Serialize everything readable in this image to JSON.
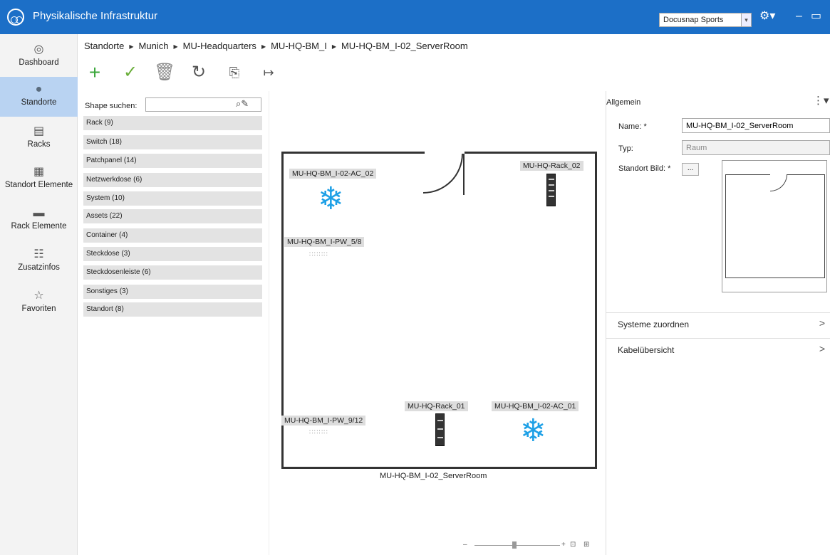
{
  "app": {
    "title": "Physikalische Infrastruktur",
    "tenant": "Docusnap Sports"
  },
  "nav": [
    {
      "label": "Dashboard",
      "icon": "dashboard-icon",
      "glyph": "◎"
    },
    {
      "label": "Standorte",
      "icon": "location-pin-icon",
      "glyph": "●"
    },
    {
      "label": "Racks",
      "icon": "rack-icon",
      "glyph": "▤"
    },
    {
      "label": "Standort Elemente",
      "icon": "site-elements-icon",
      "glyph": "▦"
    },
    {
      "label": "Rack Elemente",
      "icon": "rack-elements-icon",
      "glyph": "▬"
    },
    {
      "label": "Zusatzinfos",
      "icon": "additional-info-icon",
      "glyph": "☷"
    },
    {
      "label": "Favoriten",
      "icon": "star-icon",
      "glyph": "☆"
    }
  ],
  "breadcrumb": [
    "Standorte",
    "Munich",
    "MU-Headquarters",
    "MU-HQ-BM_I",
    "MU-HQ-BM_I-02_ServerRoom"
  ],
  "shapes": {
    "search_label": "Shape suchen:",
    "search_value": "",
    "categories": [
      "Rack (9)",
      "Switch (18)",
      "Patchpanel (14)",
      "Netzwerkdose (6)",
      "System (10)",
      "Assets (22)",
      "Container (4)",
      "Steckdose (3)",
      "Steckdosenleiste (6)",
      "Sonstiges (3)",
      "Standort (8)"
    ]
  },
  "canvas": {
    "labels": {
      "ac02": "MU-HQ-BM_I-02-AC_02",
      "rack02": "MU-HQ-Rack_02",
      "pw58": "MU-HQ-BM_I-PW_5/8",
      "rack01": "MU-HQ-Rack_01",
      "ac01": "MU-HQ-BM_I-02-AC_01",
      "pw912": "MU-HQ-BM_I-PW_9/12"
    },
    "room_caption": "MU-HQ-BM_I-02_ServerRoom"
  },
  "props": {
    "section_title": "Allgemein",
    "name_label": "Name: *",
    "name_value": "MU-HQ-BM_I-02_ServerRoom",
    "type_label": "Typ:",
    "type_value": "Raum",
    "image_label": "Standort Bild: *",
    "browse": "...",
    "sections": [
      "Systeme zuordnen",
      "Kabelübersicht"
    ]
  }
}
